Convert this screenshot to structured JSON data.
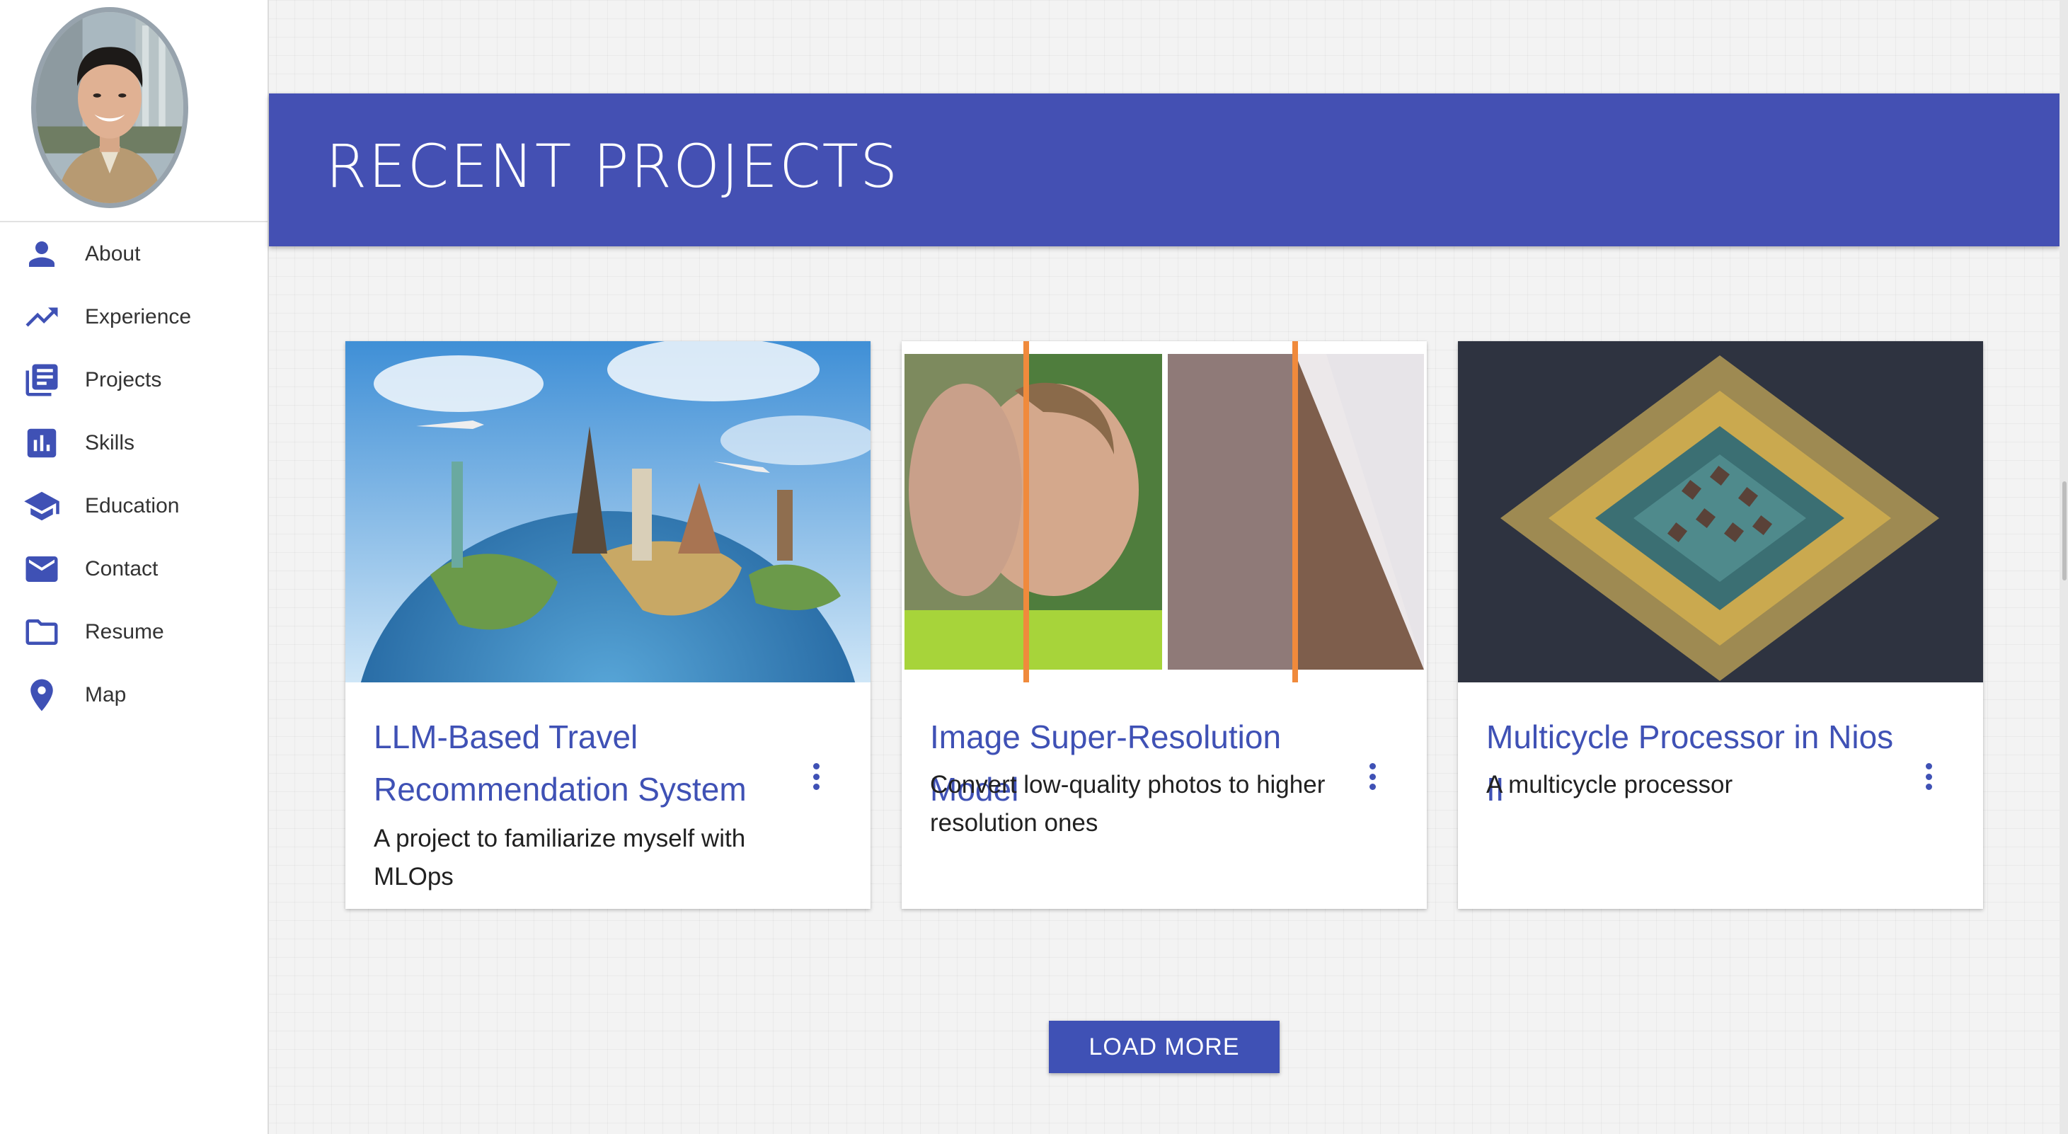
{
  "sidebar": {
    "items": [
      {
        "label": "About",
        "icon": "person-icon"
      },
      {
        "label": "Experience",
        "icon": "trending-up-icon"
      },
      {
        "label": "Projects",
        "icon": "library-books-icon"
      },
      {
        "label": "Skills",
        "icon": "bar-chart-icon"
      },
      {
        "label": "Education",
        "icon": "school-icon"
      },
      {
        "label": "Contact",
        "icon": "mail-icon"
      },
      {
        "label": "Resume",
        "icon": "folder-icon"
      },
      {
        "label": "Map",
        "icon": "location-pin-icon"
      }
    ]
  },
  "header": {
    "title": "RECENT PROJECTS"
  },
  "projects": [
    {
      "title": "LLM-Based Travel Recommendation System",
      "description": "A project to familiarize myself with MLOps"
    },
    {
      "title": "Image Super-Resolution Model",
      "description": "Convert low-quality photos to higher resolution ones"
    },
    {
      "title": "Multicycle Processor in Nios II",
      "description": "A multicycle processor"
    }
  ],
  "load_more_label": "LOAD MORE",
  "colors": {
    "primary": "#3f51b5",
    "banner": "#4450b3",
    "accent_divider": "#f08a3c"
  }
}
